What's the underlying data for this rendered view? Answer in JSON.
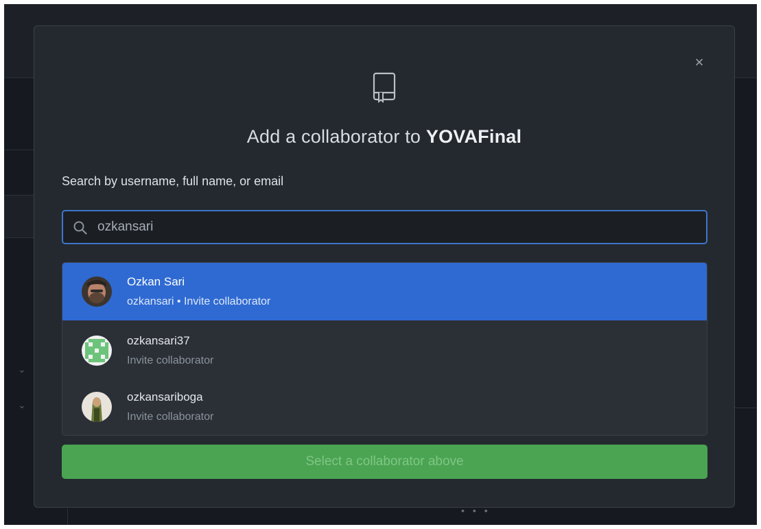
{
  "modal": {
    "title_prefix": "Add a collaborator to ",
    "repo_name": "YOVAFinal",
    "close_glyph": "×",
    "search_label": "Search by username, full name, or email",
    "search_value": "ozkansari",
    "submit_label": "Select a collaborator above",
    "repo_icon": "repo-book-icon"
  },
  "results": [
    {
      "name": "Ozkan Sari",
      "subtitle": "ozkansari • Invite collaborator",
      "selected": true
    },
    {
      "name": "ozkansari37",
      "subtitle": "Invite collaborator",
      "selected": false
    },
    {
      "name": "ozkansariboga",
      "subtitle": "Invite collaborator",
      "selected": false
    }
  ],
  "colors": {
    "modal_bg": "#24292f",
    "selected_row": "#2f6ad2",
    "search_border": "#3e76c9",
    "submit_bg": "#4aa452"
  }
}
